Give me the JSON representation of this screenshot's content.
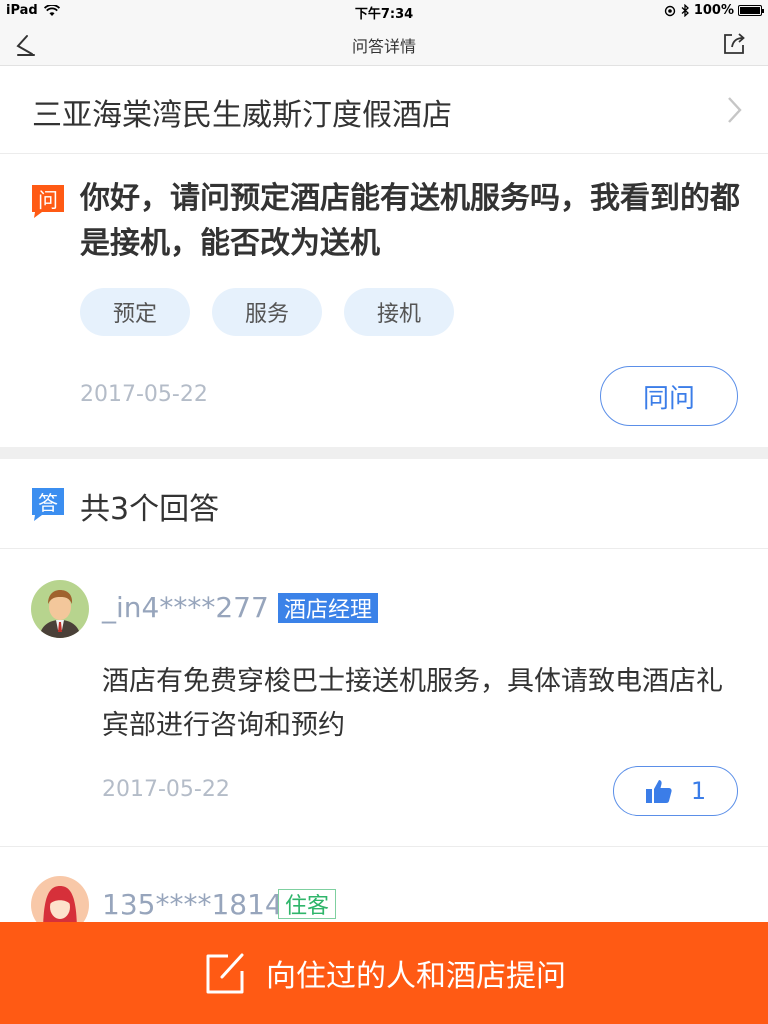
{
  "status_bar": {
    "device": "iPad",
    "time": "下午7:34",
    "battery": "100%"
  },
  "nav": {
    "title": "问答详情"
  },
  "hotel": {
    "name": "三亚海棠湾民生威斯汀度假酒店"
  },
  "question": {
    "icon_text": "问",
    "text": "你好，请问预定酒店能有送机服务吗，我看到的都是接机，能否改为送机",
    "tags": [
      "预定",
      "服务",
      "接机"
    ],
    "date": "2017-05-22",
    "same_label": "同问"
  },
  "answers": {
    "icon_text": "答",
    "count_label": "共3个回答",
    "items": [
      {
        "user": "_in4****277",
        "role": "酒店经理",
        "text": "酒店有免费穿梭巴士接送机服务，具体请致电酒店礼宾部进行咨询和预约",
        "date": "2017-05-22",
        "likes": "1"
      },
      {
        "user": "135****1814",
        "role": "住客"
      }
    ]
  },
  "ask_bar": {
    "label": "向住过的人和酒店提问"
  },
  "colors": {
    "accent_blue": "#3b7de8",
    "question_badge": "#ff5a14",
    "answer_badge": "#3b8ef0",
    "ask_bar": "#ff5a14"
  },
  "icons": [
    "wifi-icon",
    "location-icon",
    "bluetooth-icon",
    "back-arrow-icon",
    "share-icon",
    "chevron-right-icon",
    "thumbs-up-icon",
    "edit-icon"
  ]
}
